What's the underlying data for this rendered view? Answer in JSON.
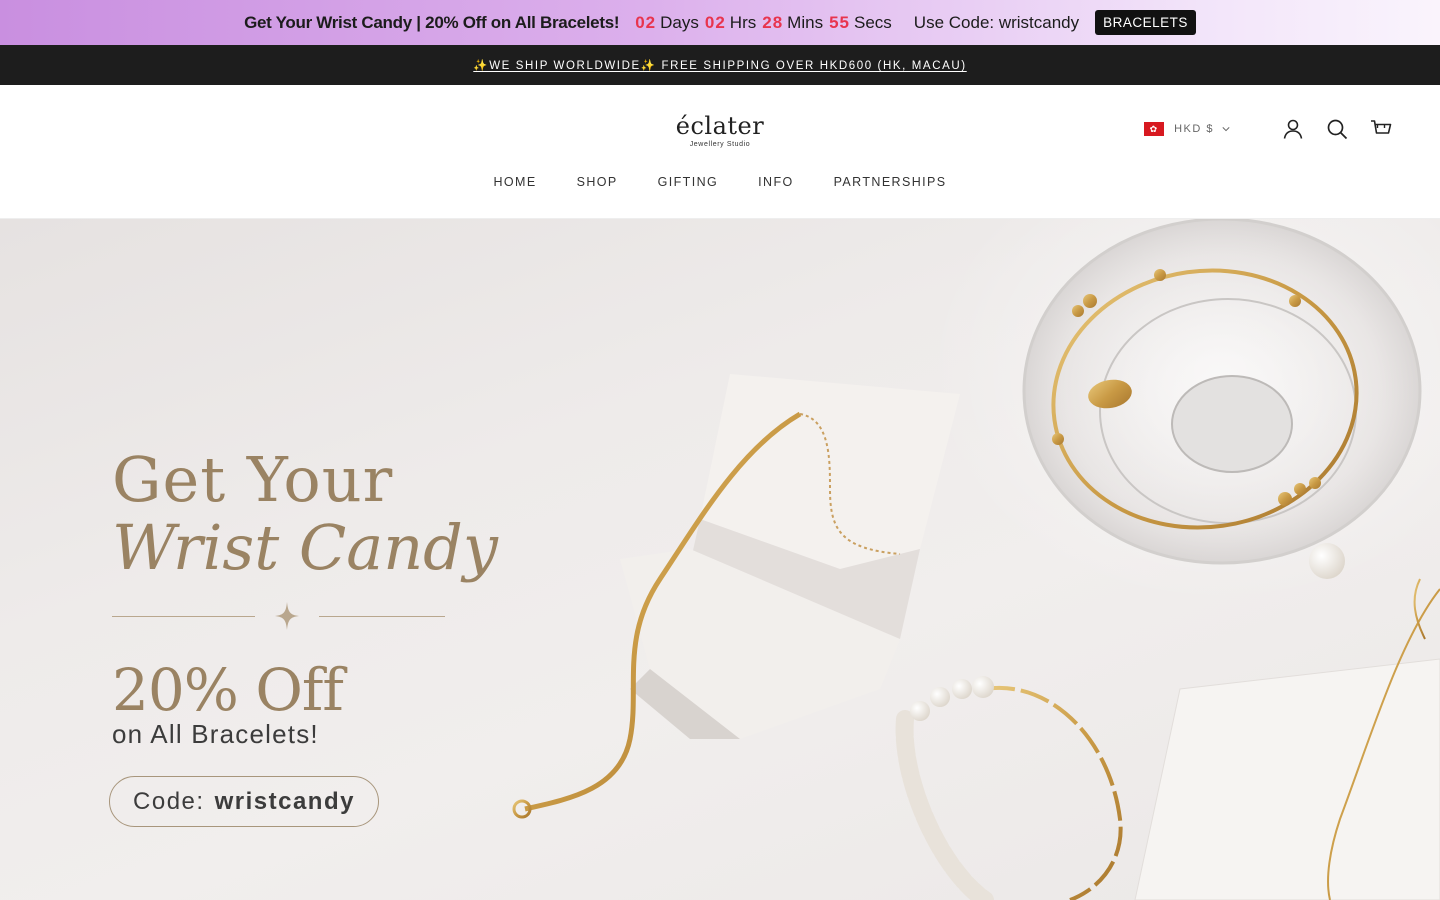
{
  "promo": {
    "headline": "Get Your Wrist Candy | 20% Off on All Bracelets!",
    "timer": [
      {
        "num": "02",
        "unit": "Days"
      },
      {
        "num": "02",
        "unit": "Hrs"
      },
      {
        "num": "28",
        "unit": "Mins"
      },
      {
        "num": "55",
        "unit": "Secs"
      }
    ],
    "code_text": "Use Code: wristcandy",
    "cta": "BRACELETS",
    "accent_color": "#e8344e"
  },
  "shipping": {
    "text": "✨WE SHIP WORLDWIDE✨ FREE SHIPPING OVER HKD600 (HK, MACAU)"
  },
  "header": {
    "logo": {
      "word": "éclater",
      "sub": "Jewellery Studio"
    },
    "nav": [
      "HOME",
      "SHOP",
      "GIFTING",
      "INFO",
      "PARTNERSHIPS"
    ],
    "currency": "HKD $",
    "icons": [
      "hk-flag-icon",
      "chevron-down-icon",
      "account-icon",
      "search-icon",
      "cart-icon"
    ]
  },
  "hero": {
    "title_line1": "Get Your",
    "title_line2": "Wrist Candy",
    "discount": "20% Off",
    "subtitle": "on All Bracelets!",
    "code_label": "Code:",
    "code_value": "wristcandy",
    "accent_color": "#9a8363"
  }
}
